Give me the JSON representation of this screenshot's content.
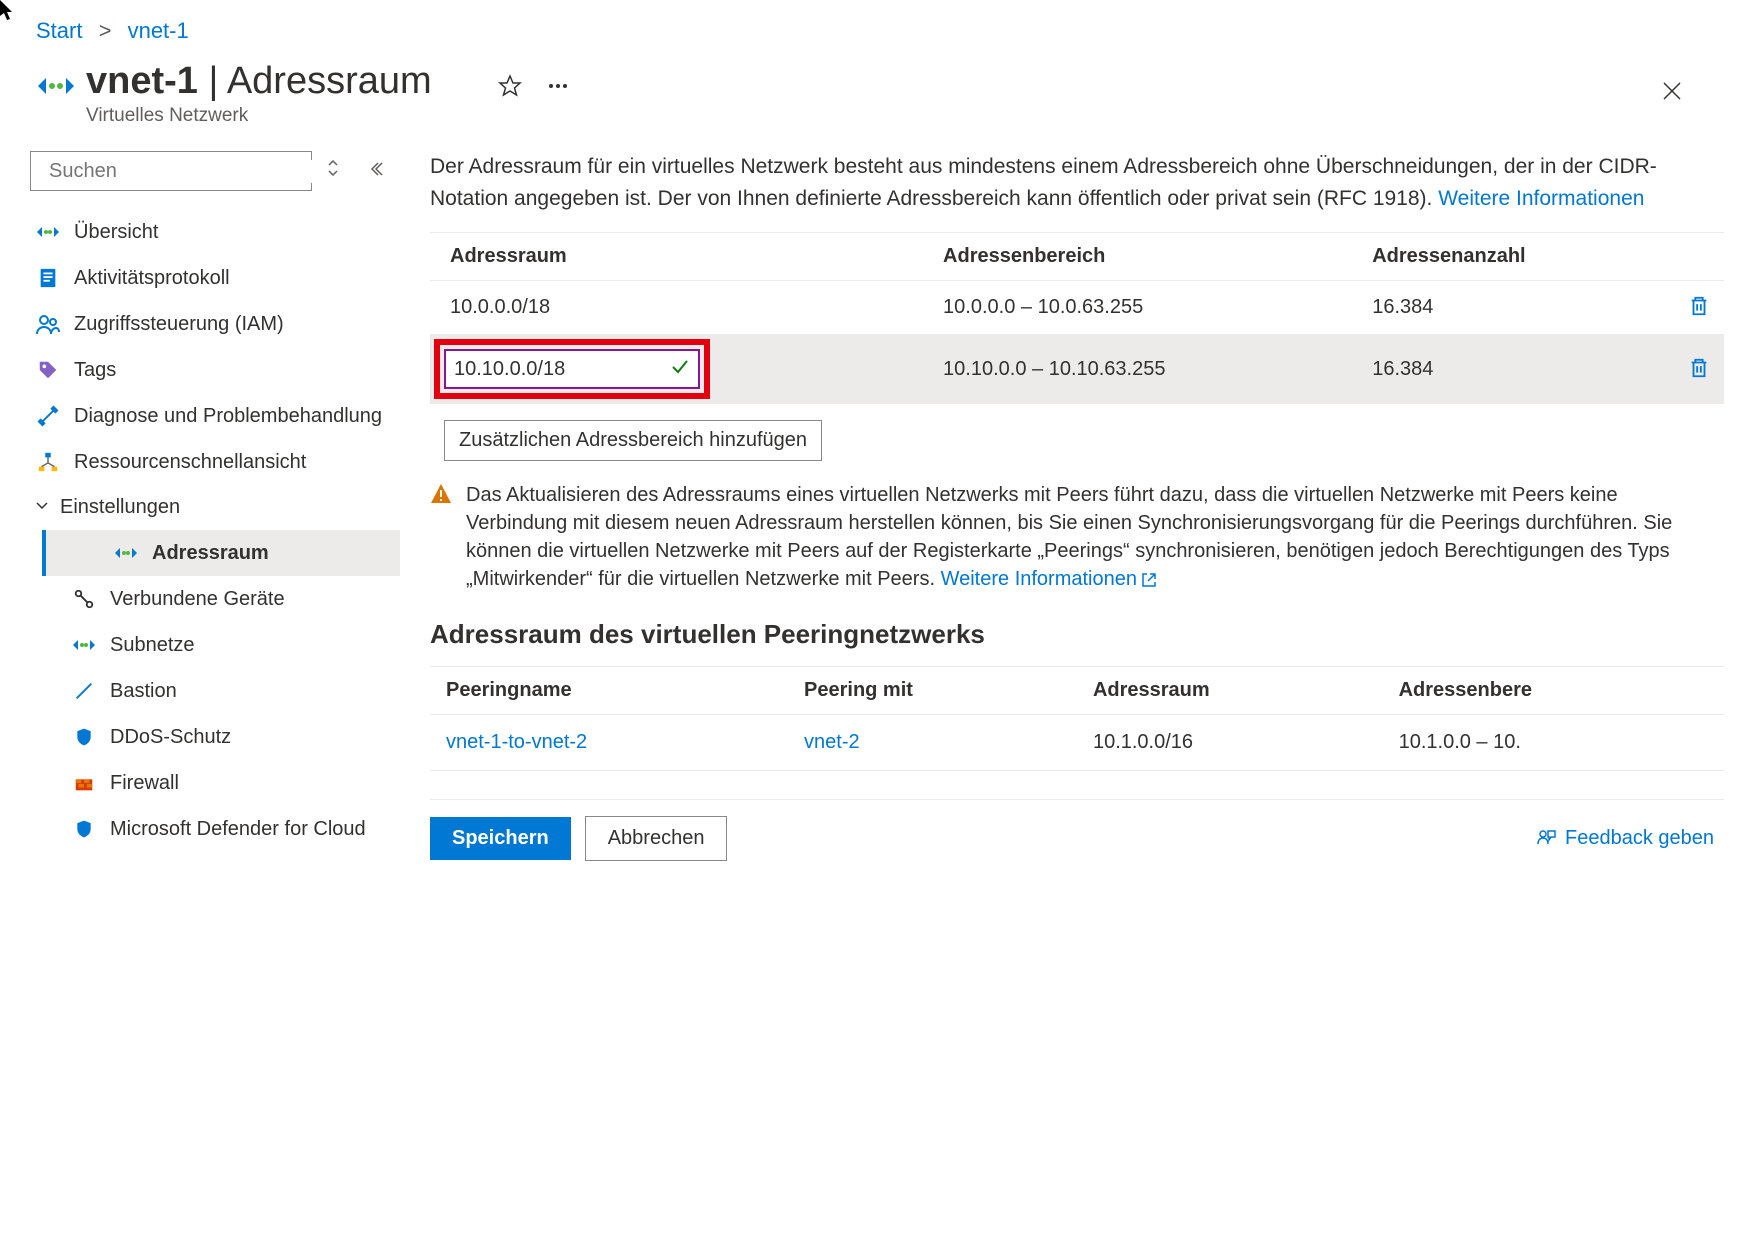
{
  "breadcrumb": {
    "start": "Start",
    "current": "vnet-1"
  },
  "header": {
    "title_bold": "vnet-1",
    "title_rest": "Adressraum",
    "subtitle": "Virtuelles Netzwerk"
  },
  "search": {
    "placeholder": "Suchen"
  },
  "nav": {
    "overview": "Übersicht",
    "activity_log": "Aktivitätsprotokoll",
    "iam": "Zugriffssteuerung (IAM)",
    "tags": "Tags",
    "diagnose": "Diagnose und Problembehandlung",
    "resource_view": "Ressourcenschnellansicht",
    "settings_group": "Einstellungen",
    "address_space": "Adressraum",
    "connected_devices": "Verbundene Geräte",
    "subnets": "Subnetze",
    "bastion": "Bastion",
    "ddos": "DDoS-Schutz",
    "firewall": "Firewall",
    "defender": "Microsoft Defender for Cloud"
  },
  "intro": {
    "text": "Der Adressraum für ein virtuelles Netzwerk besteht aus mindestens einem Adressbereich ohne Überschneidungen, der in der CIDR-Notation angegeben ist. Der von Ihnen definierte Adressbereich kann öffentlich oder privat sein (RFC 1918). ",
    "link": "Weitere Informationen"
  },
  "addr_columns": {
    "space": "Adressraum",
    "range": "Adressenbereich",
    "count": "Adressenanzahl"
  },
  "addr_rows": [
    {
      "space": "10.0.0.0/18",
      "range": "10.0.0.0 – 10.0.63.255",
      "count": "16.384"
    },
    {
      "space": "10.10.0.0/18",
      "range": "10.10.0.0 – 10.10.63.255",
      "count": "16.384"
    }
  ],
  "add_range_btn": "Zusätzlichen Adressbereich hinzufügen",
  "warning": {
    "text": "Das Aktualisieren des Adressraums eines virtuellen Netzwerks mit Peers führt dazu, dass die virtuellen Netzwerke mit Peers keine Verbindung mit diesem neuen Adressraum herstellen können, bis Sie einen Synchronisierungsvorgang für die Peerings durchführen. Sie können die virtuellen Netzwerke mit Peers auf der Registerkarte „Peerings“ synchronisieren, benötigen jedoch Berechtigungen des Typs „Mitwirkender“ für die virtuellen Netzwerke mit Peers. ",
    "link": "Weitere Informationen"
  },
  "peering_section": "Adressraum des virtuellen Peeringnetzwerks",
  "peer_columns": {
    "name": "Peeringname",
    "with": "Peering mit",
    "space": "Adressraum",
    "range": "Adressenbere"
  },
  "peer_rows": [
    {
      "name": "vnet-1-to-vnet-2",
      "with": "vnet-2",
      "space": "10.1.0.0/16",
      "range": "10.1.0.0 – 10."
    }
  ],
  "footer": {
    "save": "Speichern",
    "cancel": "Abbrechen",
    "feedback": "Feedback geben"
  }
}
